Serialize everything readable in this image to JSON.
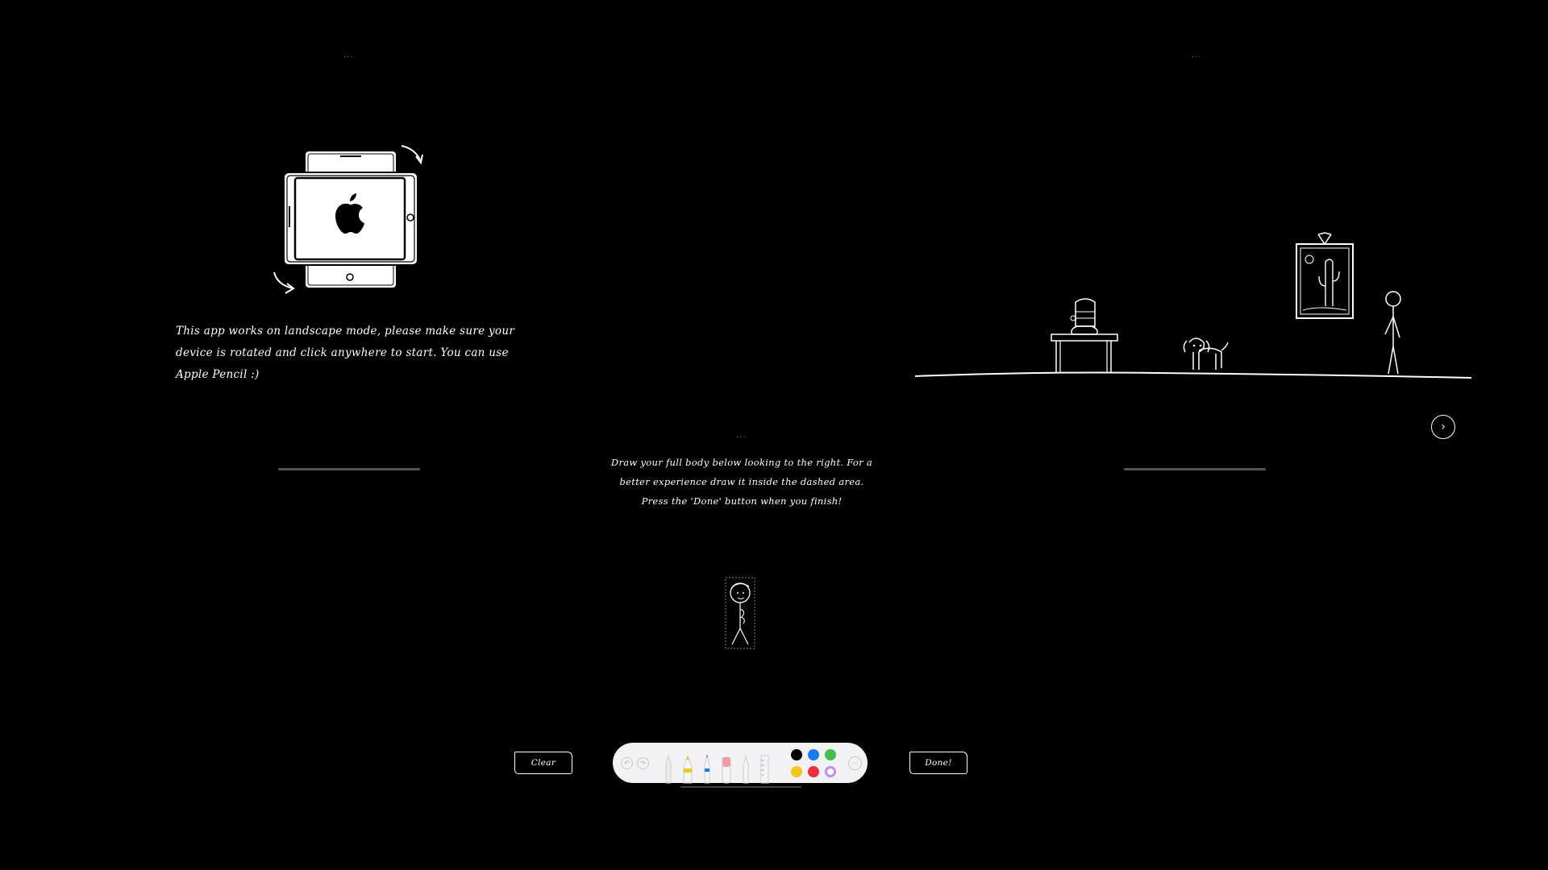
{
  "left_screen": {
    "rotate_message": "This app works on landscape mode, please make sure your device is rotated and click anywhere to start. You can use Apple Pencil :)"
  },
  "center_screen": {
    "instructions": "Draw your full body below looking to the right. For a better experience draw it inside the dashed area. Press the 'Done' button when you finish!",
    "clear_label": "Clear",
    "done_label": "Done!",
    "tool_palette": {
      "tools": [
        "pencil-tool",
        "marker-tool",
        "pen-tool",
        "eraser-tool",
        "lasso-tool",
        "ruler-tool"
      ],
      "colors": [
        "#000000",
        "#1a7cf5",
        "#3ec14a",
        "#f5c518",
        "#f02d3a",
        "#ffffff"
      ],
      "selected_color": "#ffffff"
    }
  },
  "right_screen": {
    "next_icon": "chevron-right-icon"
  }
}
